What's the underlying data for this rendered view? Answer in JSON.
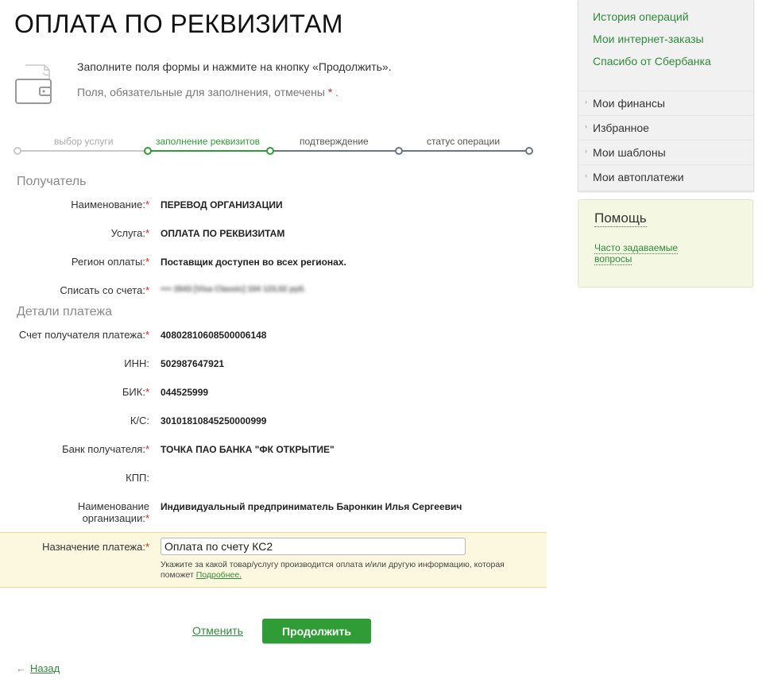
{
  "header": {
    "title": "ОПЛАТА ПО РЕКВИЗИТАМ",
    "intro_line1": "Заполните поля формы и нажмите на кнопку «Продолжить».",
    "intro_line2": "Поля, обязательные для заполнения, отмечены",
    "required_mark": "*",
    "intro_line2_end": "."
  },
  "steps": [
    {
      "label": "выбор услуги",
      "state": "done"
    },
    {
      "label": "заполнение реквизитов",
      "state": "current"
    },
    {
      "label": "подтверждение",
      "state": "upcoming"
    },
    {
      "label": "статус операции",
      "state": "upcoming"
    }
  ],
  "colors": {
    "accent_green": "#2f9c35",
    "link_green": "#2e8b3a",
    "required_red": "#e02020",
    "step_done_gray": "#c8c8c8",
    "step_upcoming_gray": "#6b7680",
    "highlight_bg": "#fcf8df"
  },
  "recipient": {
    "section_title": "Получатель",
    "fields": [
      {
        "label": "Наименование:",
        "required": true,
        "value": "ПЕРЕВОД ОРГАНИЗАЦИИ"
      },
      {
        "label": "Услуга:",
        "required": true,
        "value": "ОПЛАТА ПО РЕКВИЗИТАМ"
      },
      {
        "label": "Регион оплаты:",
        "required": true,
        "value": "Поставщик доступен во всех регионах."
      },
      {
        "label": "Списать со счета:",
        "required": true,
        "value": "•••• 2643 [Visa Classic] 104 123,02 руб."
      }
    ]
  },
  "payment": {
    "section_title": "Детали платежа",
    "fields": [
      {
        "label": "Счет получателя платежа:",
        "required": true,
        "value": "40802810608500006148"
      },
      {
        "label": "ИНН:",
        "required": false,
        "value": "502987647921"
      },
      {
        "label": "БИК:",
        "required": true,
        "value": "044525999"
      },
      {
        "label": "К/С:",
        "required": false,
        "value": "30101810845250000999"
      },
      {
        "label": "Банк получателя:",
        "required": true,
        "value": "ТОЧКА ПАО БАНКА \"ФК ОТКРЫТИЕ\""
      },
      {
        "label": "КПП:",
        "required": false,
        "value": ""
      }
    ],
    "org_label_line1": "Наименование",
    "org_label_line2": "организации:",
    "org_value": "Индивидуальный предприниматель Баронкин Илья Сергеевич"
  },
  "purpose": {
    "label": "Назначение платежа:",
    "value": "Оплата по счету КС2",
    "hint": "Укажите за какой товар/услугу производится оплата и/или другую информацию, которая поможет",
    "hint_link": "Подробнее."
  },
  "actions": {
    "cancel_label": "Отменить",
    "continue_label": "Продолжить",
    "back_arrow": "←",
    "back_label": "Назад"
  },
  "sidebar": {
    "links": [
      "История операций",
      "Мои интернет-заказы",
      "Спасибо от Сбербанка"
    ],
    "items": [
      "Мои финансы",
      "Избранное",
      "Мои шаблоны",
      "Мои автоплатежи"
    ],
    "chevron": "›"
  },
  "help": {
    "title": "Помощь",
    "link": "Часто задаваемые вопросы"
  }
}
